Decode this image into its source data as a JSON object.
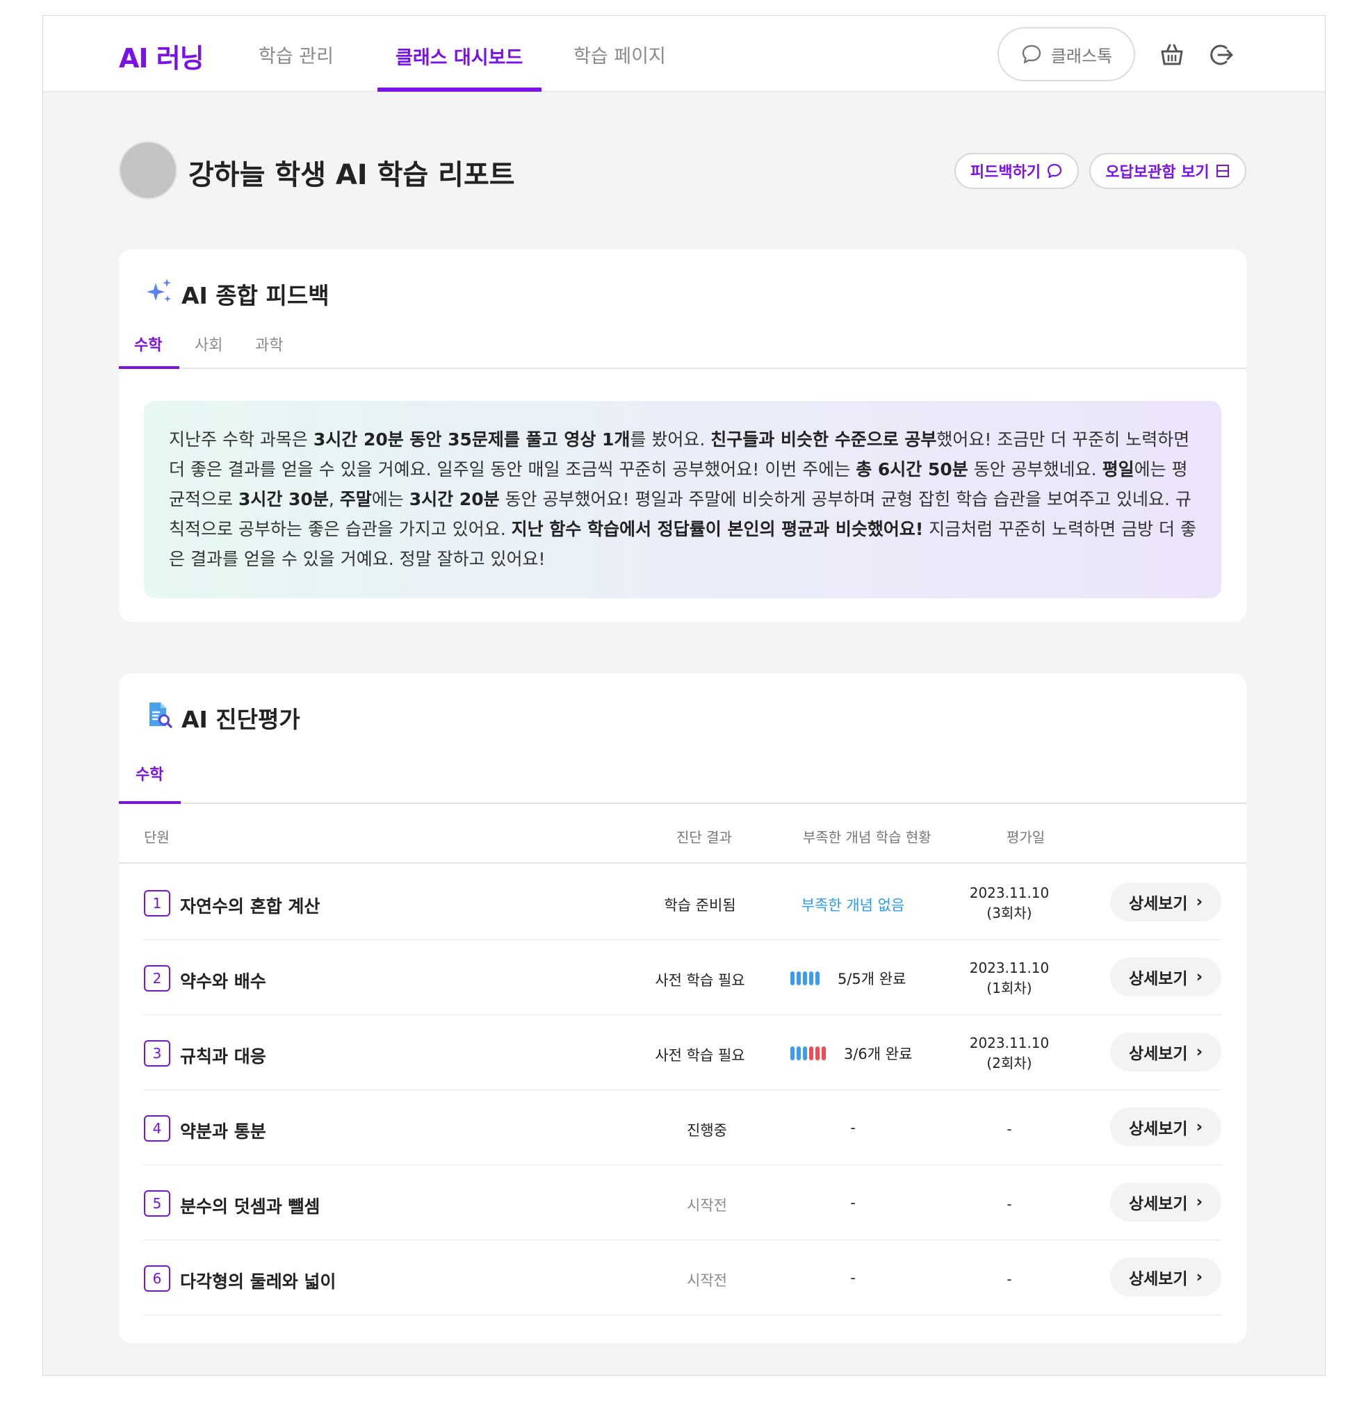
{
  "header": {
    "logo": "AI 러닝",
    "nav": [
      "학습 관리",
      "클래스 대시보드",
      "학습 페이지"
    ],
    "talk_label": "클래스톡",
    "icons": [
      "chat-icon",
      "basket-icon",
      "logout-icon"
    ],
    "accent": "#7a12e8"
  },
  "report": {
    "title": "강하늘 학생 AI 학습 리포트",
    "feedback_button": "피드백하기",
    "wrong_note_button": "오답보관함 보기"
  },
  "feedback_card": {
    "title": "AI 종합 피드백",
    "tabs": [
      "수학",
      "사회",
      "과학"
    ],
    "active_tab": "수학",
    "text": {
      "s1": "지난주 수학 과목은 ",
      "b1": "3시간 20분 동안 35문제를 풀고 영상 1개",
      "s2": "를 봤어요. ",
      "b2": "친구들과 비슷한 수준으로 공부",
      "s3": "했어요! 조금만 더 꾸준히 노력하면 더 좋은 결과를 얻을 수 있을 거예요. 일주일 동안 매일 조금씩 꾸준히 공부했어요! 이번 주에는 ",
      "b3": "총 6시간 50분",
      "s4": " 동안 공부했네요. ",
      "b4": "평일",
      "s5": "에는 평균적으로 ",
      "b5": "3시간 30분",
      "s6": ", ",
      "b6": "주말",
      "s7": "에는 ",
      "b7": "3시간 20분",
      "s8": " 동안 공부했어요! 평일과 주말에 비슷하게 공부하며 균형 잡힌 학습 습관을 보여주고 있네요. 규칙적으로 공부하는 좋은 습관을 가지고 있어요. ",
      "b8": "지난 함수 학습에서 정답률이 본인의 평균과 비슷했어요!",
      "s9": " 지금처럼 꾸준히 노력하면 금방 더 좋은 결과를 얻을 수 있을 거예요. 정말 잘하고 있어요!"
    }
  },
  "diagnosis_card": {
    "title": "AI 진단평가",
    "tabs": [
      "수학"
    ],
    "columns": [
      "단원",
      "진단 결과",
      "부족한 개념 학습 현황",
      "평가일"
    ],
    "detail_label": "상세보기",
    "rows": [
      {
        "num": "1",
        "unit": "자연수의 혼합 계산",
        "result": "학습 준비됨",
        "concept": "부족한 개념 없음",
        "date": "2023.11.10",
        "round": "(3회차)"
      },
      {
        "num": "2",
        "unit": "약수와 배수",
        "result": "사전 학습 필요",
        "progress": "5/5개 완료",
        "done": 5,
        "total": 5,
        "date": "2023.11.10",
        "round": "(1회차)"
      },
      {
        "num": "3",
        "unit": "규칙과 대응",
        "result": "사전 학습 필요",
        "progress": "3/6개 완료",
        "done": 3,
        "total": 6,
        "date": "2023.11.10",
        "round": "(2회차)"
      },
      {
        "num": "4",
        "unit": "약분과 통분",
        "result": "진행중",
        "concept": "-",
        "date": "-"
      },
      {
        "num": "5",
        "unit": "분수의 덧셈과 뺄셈",
        "result": "시작전",
        "concept": "-",
        "date": "-"
      },
      {
        "num": "6",
        "unit": "다각형의 둘레와 넓이",
        "result": "시작전",
        "concept": "-",
        "date": "-"
      }
    ],
    "colors": {
      "done_bar": "#3b9cf0",
      "todo_bar": "#f04b55",
      "no_concept": "#2b9bf0"
    }
  }
}
